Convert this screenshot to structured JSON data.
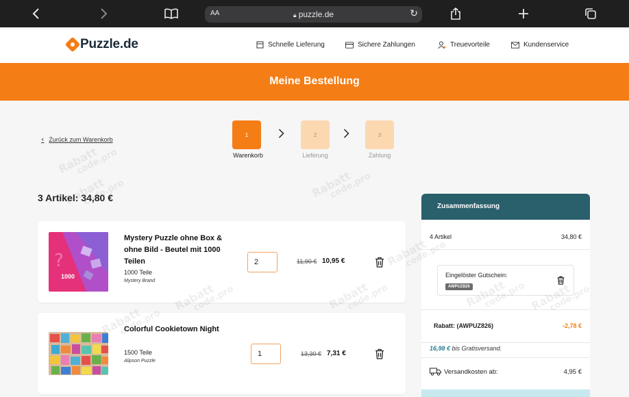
{
  "browser": {
    "text_size_label": "AA",
    "url": "puzzle.de",
    "icons": [
      "back-icon",
      "forward-icon",
      "bookmarks-icon",
      "lock-icon",
      "reload-icon",
      "share-icon",
      "new-tab-icon",
      "tabs-icon"
    ]
  },
  "header": {
    "logo_text": "Puzzle.de",
    "nav": [
      {
        "label": "Schnelle Lieferung",
        "icon": "box-icon"
      },
      {
        "label": "Sichere Zahlungen",
        "icon": "credit-card-icon"
      },
      {
        "label": "Treuevorteile",
        "icon": "loyalty-icon"
      },
      {
        "label": "Kundenservice",
        "icon": "mail-icon"
      }
    ]
  },
  "banner": {
    "title": "Meine Bestellung"
  },
  "back_link": "Zurück zum Warenkorb",
  "steps": [
    {
      "number": "1",
      "label": "Warenkorb",
      "active": true
    },
    {
      "number": "2",
      "label": "Lieferung",
      "active": false
    },
    {
      "number": "3",
      "label": "Zahlung",
      "active": false
    }
  ],
  "cart_heading": "3 Artikel: 34,80 €",
  "items": [
    {
      "title": "Mystery Puzzle ohne Box & ohne Bild - Beutel mit 1000 Teilen",
      "pieces": "1000 Teile",
      "brand": "Mystery Brand",
      "thumb_text": "1000",
      "quantity": "2",
      "old_price": "11,90 €",
      "price": "10,95 €"
    },
    {
      "title": "Colorful Cookietown Night",
      "pieces": "1500 Teile",
      "brand": "Alipson Puzzle",
      "quantity": "1",
      "old_price": "13,30 €",
      "price": "7,31 €"
    }
  ],
  "summary": {
    "title": "Zusammenfassung",
    "articles_label": "4 Artikel",
    "articles_value": "34,80 €",
    "coupon_title": "Eingelöster Gutschein:",
    "coupon_code": "AWPUZ826",
    "discount_label": "Rabatt: (AWPUZ826)",
    "discount_value": "-2,78 €",
    "free_shipping_amount": "16,98 €",
    "free_shipping_text": "bis Gratisversand.",
    "shipping_label": "Versandkosten ab:",
    "shipping_value": "4,95 €"
  },
  "watermark": {
    "line1": "Rabatt",
    "line2": "code.pro"
  },
  "colors": {
    "brand_orange": "#f57d15",
    "summary_teal": "#2a5f6c",
    "step_inactive": "#fcd8b1"
  }
}
